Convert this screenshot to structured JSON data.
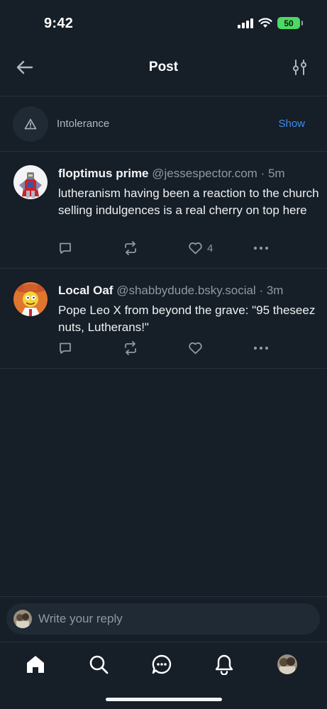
{
  "status_bar": {
    "time": "9:42",
    "battery": "50"
  },
  "header": {
    "title": "Post"
  },
  "content_warning": {
    "label": "Intolerance",
    "show_label": "Show"
  },
  "posts": [
    {
      "author": "floptimus prime",
      "handle": "@jessespector.com",
      "time": "· 5m",
      "text": "lutheranism having been a reaction to the church selling indulgences is a real cherry on top here",
      "like_count": "4"
    },
    {
      "author": "Local Oaf",
      "handle": "@shabbydude.bsky.social",
      "time": "· 3m",
      "text": "Pope Leo X from beyond the grave: \"95 theseez nuts, Lutherans!\"",
      "like_count": ""
    }
  ],
  "reply": {
    "placeholder": "Write your reply"
  },
  "colors": {
    "accent": "#3d8ff0",
    "background": "#161e27",
    "muted": "#8d99a6",
    "battery": "#4cd964"
  },
  "tabbar": {
    "items": [
      "home-icon",
      "search-icon",
      "chat-icon",
      "bell-icon",
      "profile-avatar"
    ]
  }
}
